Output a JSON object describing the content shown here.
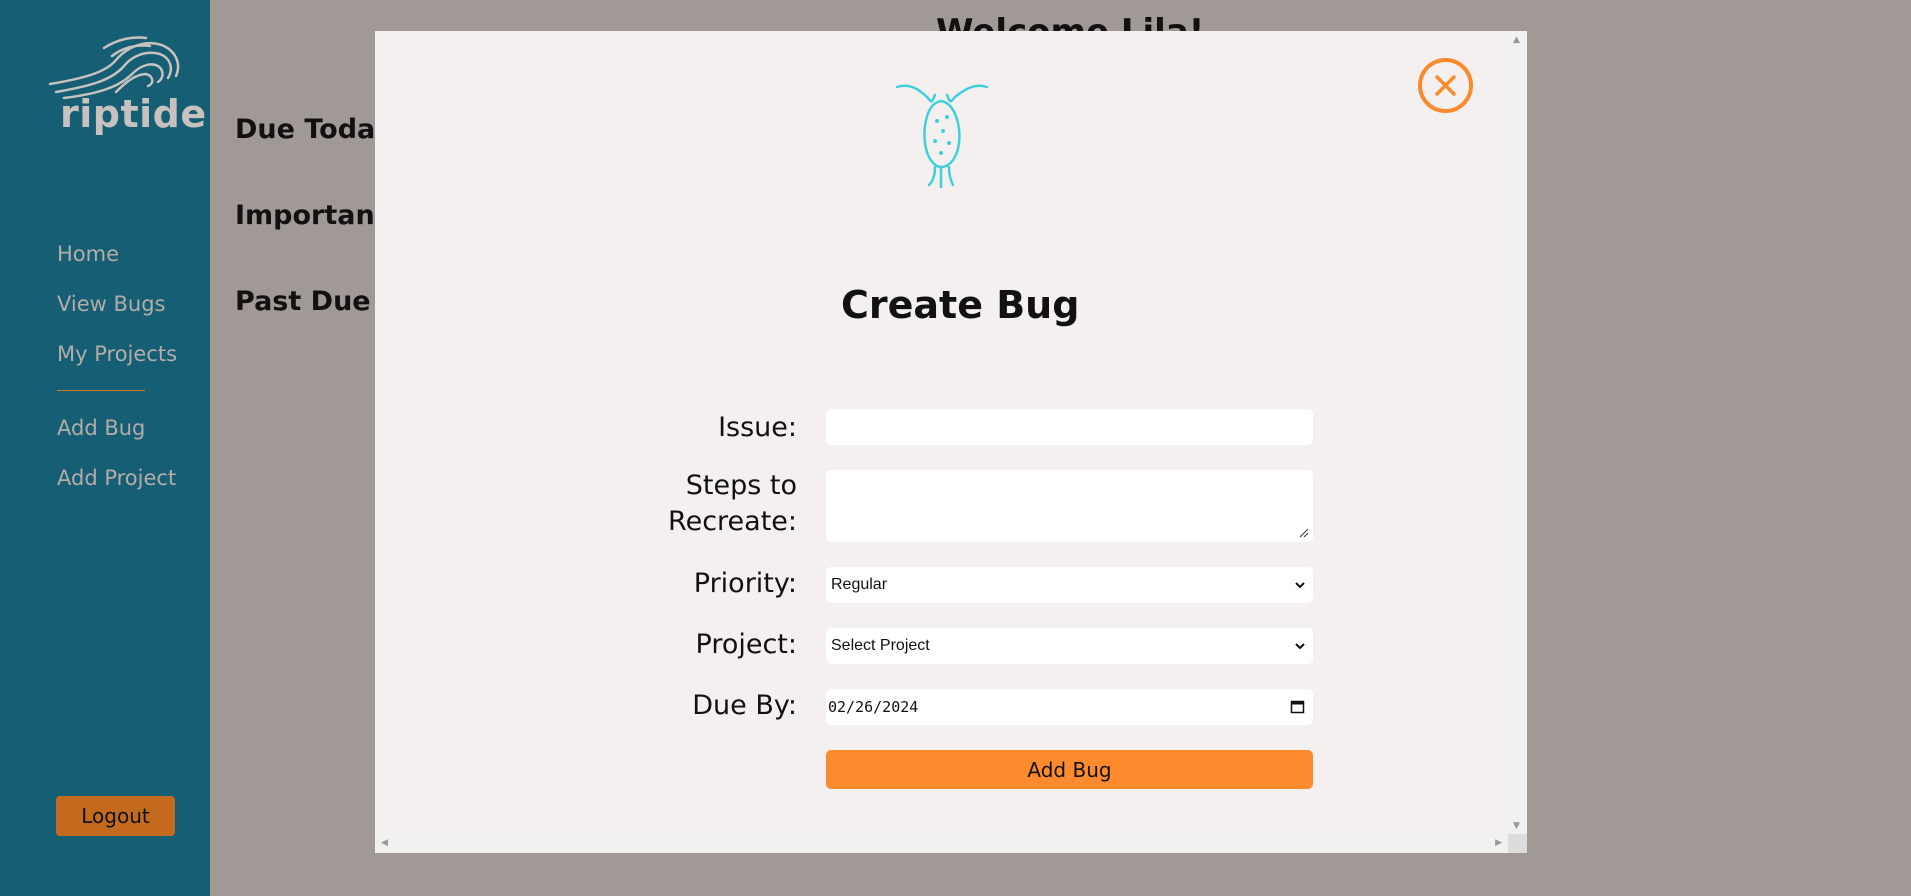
{
  "app": {
    "name": "riptide"
  },
  "sidebar": {
    "items": [
      {
        "label": "Home"
      },
      {
        "label": "View Bugs"
      },
      {
        "label": "My Projects"
      },
      {
        "label": "Add Bug"
      },
      {
        "label": "Add Project"
      }
    ],
    "logout_label": "Logout"
  },
  "background": {
    "title": "Welcome Lila!",
    "sections": [
      "Due Today",
      "Important",
      "Past Due"
    ]
  },
  "modal": {
    "title": "Create Bug",
    "close_icon": "close-icon",
    "bug_icon": "bug-icon",
    "form": {
      "issue_label": "Issue:",
      "issue_value": "",
      "steps_label_line1": "Steps to",
      "steps_label_line2": "Recreate:",
      "steps_value": "",
      "priority_label": "Priority:",
      "priority_value": "Regular",
      "project_label": "Project:",
      "project_value": "Select Project",
      "due_label": "Due By:",
      "due_value": "02/26/2024",
      "submit_label": "Add Bug"
    }
  },
  "colors": {
    "sidebar": "#165e74",
    "accent": "#fd8b2d",
    "logout": "#c46a1f",
    "overlay": "#a19995",
    "modal_bg": "#f4f0ef",
    "bug_icon": "#3fd0dc"
  }
}
